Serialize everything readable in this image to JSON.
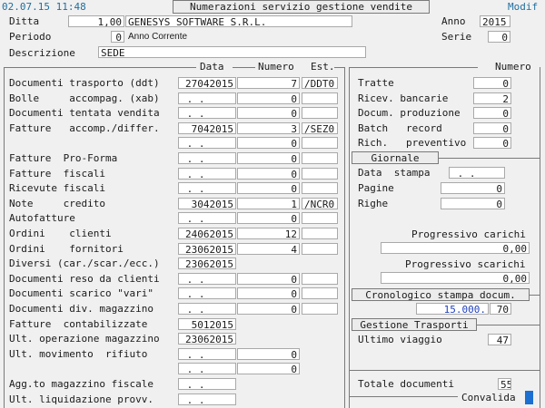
{
  "topbar": {
    "datetime": "02.07.15 11:48",
    "title": "Numerazioni servizio gestione vendite",
    "mode": "Modif"
  },
  "header": {
    "ditta_label": "Ditta",
    "ditta_code": "1,00",
    "ditta_name": "GENESYS SOFTWARE S.R.L.",
    "anno_label": "Anno",
    "anno_value": "2015",
    "periodo_label": "Periodo",
    "periodo_value": "0",
    "periodo_desc": "Anno Corrente",
    "serie_label": "Serie",
    "serie_value": "0",
    "descrizione_label": "Descrizione",
    "descrizione_value": "SEDE"
  },
  "columns": {
    "data": "Data",
    "numero": "Numero",
    "est": "Est.",
    "numero_right": "Numero"
  },
  "left_rows": [
    {
      "label": "Documenti trasporto (ddt)",
      "date": "27042015",
      "num": "7",
      "est": "/DDT0"
    },
    {
      "label": "Bolle     accompag. (xab)",
      "date": " . .     0",
      "num": "0",
      "est": ""
    },
    {
      "label": "Documenti tentata vendita",
      "date": " . .     0",
      "num": "0",
      "est": ""
    },
    {
      "label": "Fatture   accomp./differ.",
      "date": "7042015",
      "num": "3",
      "est": "/SEZ0"
    },
    {
      "label": "",
      "date": " . .     0",
      "num": "0",
      "est": ""
    },
    {
      "label": "Fatture  Pro-Forma",
      "date": " . .     0",
      "num": "0",
      "est": ""
    },
    {
      "label": "Fatture  fiscali",
      "date": " . .     0",
      "num": "0",
      "est": ""
    },
    {
      "label": "Ricevute fiscali",
      "date": " . .     0",
      "num": "0",
      "est": ""
    },
    {
      "label": "Note     credito",
      "date": "3042015",
      "num": "1",
      "est": "/NCR0"
    },
    {
      "label": "Autofatture",
      "date": " . .     0",
      "num": "0",
      "est": ""
    },
    {
      "label": "Ordini    clienti",
      "date": "24062015",
      "num": "12",
      "est": ""
    },
    {
      "label": "Ordini    fornitori",
      "date": "23062015",
      "num": "4",
      "est": ""
    },
    {
      "label": "Diversi (car./scar./ecc.)",
      "date": "23062015",
      "num": null,
      "est": null
    },
    {
      "label": "Documenti reso da clienti",
      "date": " . .     0",
      "num": "0",
      "est": ""
    },
    {
      "label": "Documenti scarico \"vari\"",
      "date": " . .     0",
      "num": "0",
      "est": ""
    },
    {
      "label": "Documenti div. magazzino",
      "date": " . .     0",
      "num": "0",
      "est": ""
    },
    {
      "label": "Fatture  contabilizzate",
      "date": "5012015",
      "num": null,
      "est": null
    },
    {
      "label": "Ult. operazione magazzino",
      "date": "23062015",
      "num": null,
      "est": null
    },
    {
      "label": "Ult. movimento  rifiuto",
      "date": " . .     0",
      "num": "0",
      "est": null
    },
    {
      "label": "",
      "date": " . .     0",
      "num": "0",
      "est": null
    },
    {
      "label": "Agg.to magazzino fiscale",
      "date": " . .     0",
      "num": null,
      "est": null
    },
    {
      "label": "Ult. liquidazione provv.",
      "date": " . .     0",
      "num": null,
      "est": null
    }
  ],
  "right_rows": [
    {
      "label": "Tratte",
      "value": "0"
    },
    {
      "label": "Ricev. bancarie",
      "value": "2"
    },
    {
      "label": "Docum. produzione",
      "value": "0"
    },
    {
      "label": "Batch   record",
      "value": "0"
    },
    {
      "label": "Rich.   preventivo",
      "value": "0"
    }
  ],
  "giornale": {
    "title": "Giornale",
    "data_stampa_label": "Data  stampa",
    "data_stampa_value": " . .     0",
    "pagine_label": "Pagine",
    "pagine_value": "0",
    "righe_label": "Righe",
    "righe_value": "0"
  },
  "progressivi": {
    "carichi_label": "Progressivo carichi",
    "carichi_value": "0,00",
    "scarichi_label": "Progressivo scarichi",
    "scarichi_value": "0,00"
  },
  "cronologico": {
    "title": "Cronologico stampa docum.",
    "num_value": "15.000.",
    "count_value": "70"
  },
  "trasporti": {
    "title": "Gestione Trasporti",
    "ultimo_viaggio_label": "Ultimo viaggio",
    "ultimo_viaggio_value": "47"
  },
  "totale": {
    "label": "Totale documenti",
    "value": "55"
  },
  "footer": {
    "validate_label": "Convalida"
  },
  "colors": {
    "accent": "#1a6fd1",
    "blue_text": "#1f3fbf"
  }
}
